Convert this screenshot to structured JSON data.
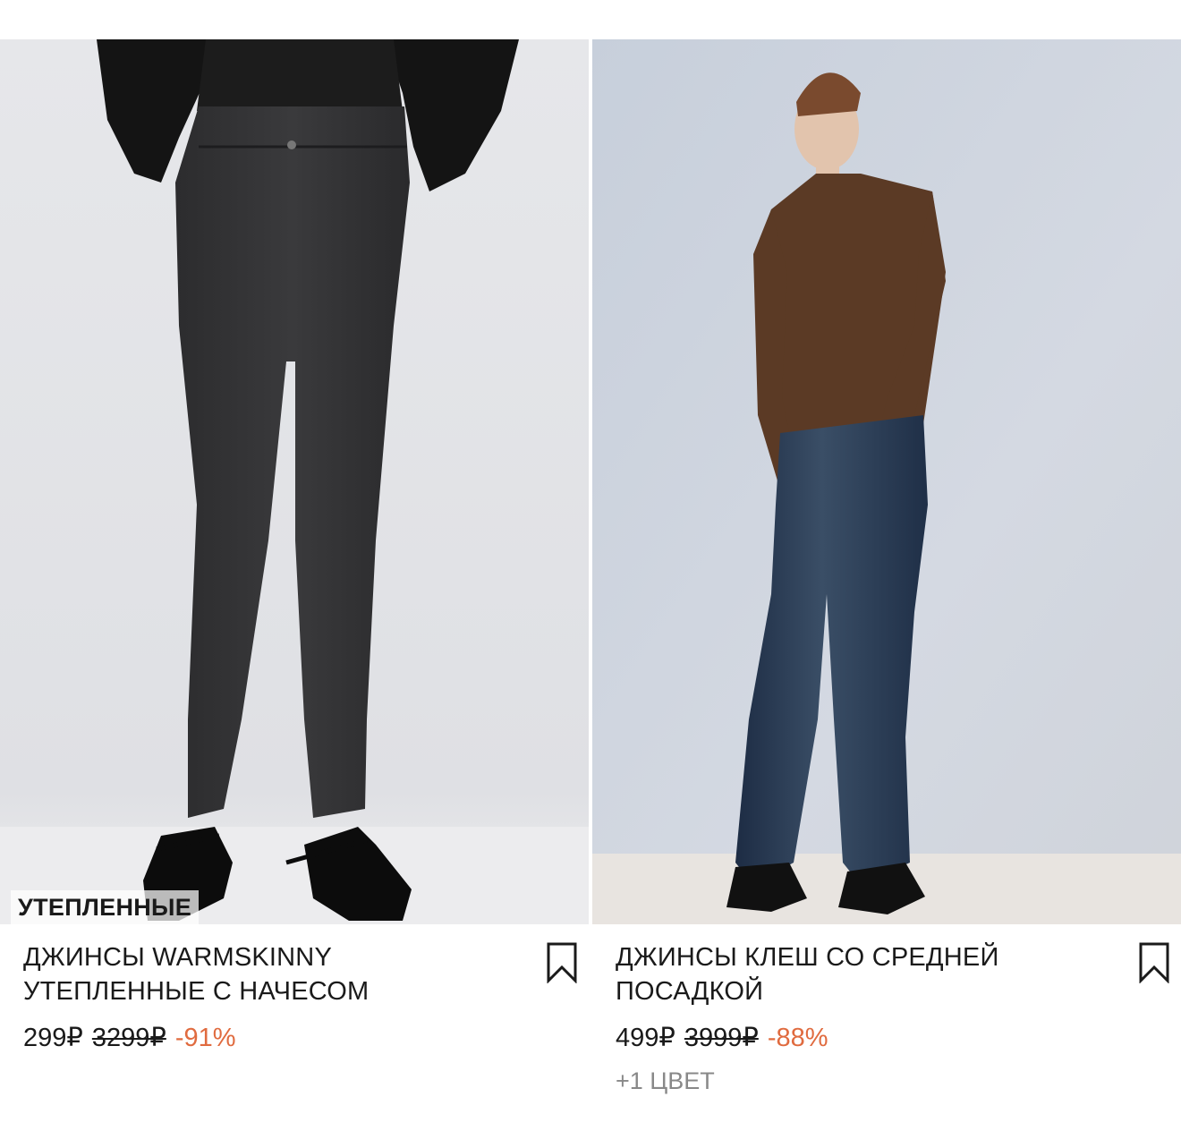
{
  "products": [
    {
      "badge": "УТЕПЛЕННЫЕ",
      "title": "ДЖИНСЫ WARMSKINNY УТЕПЛЕННЫЕ С НАЧЕСОМ",
      "price": "299₽",
      "old_price": "3299₽",
      "discount": "-91%",
      "colors_note": "",
      "bookmark_icon": "bookmark-icon"
    },
    {
      "badge": "",
      "title": "ДЖИНСЫ КЛЕШ СО СРЕДНЕЙ ПОСАДКОЙ",
      "price": "499₽",
      "old_price": "3999₽",
      "discount": "-88%",
      "colors_note": "+1 ЦВЕТ",
      "bookmark_icon": "bookmark-icon"
    }
  ],
  "colors": {
    "discount": "#e06b3f",
    "text": "#1a1a1a",
    "muted": "#888888"
  }
}
